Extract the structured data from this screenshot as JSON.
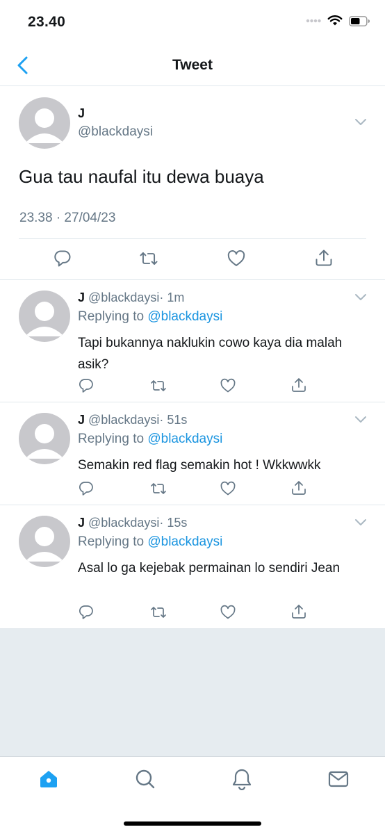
{
  "status_bar": {
    "time": "23.40"
  },
  "nav": {
    "title": "Tweet",
    "back_icon": "chevron-left-icon"
  },
  "main_tweet": {
    "name": "J",
    "handle": "@blackdaysi",
    "text": "Gua tau naufal itu dewa buaya",
    "timestamp": "23.38 · 27/04/23"
  },
  "replies": [
    {
      "name": "J",
      "handle": "@blackdaysi",
      "time": "· 1m",
      "replying_label": "Replying to",
      "replying_to": "@blackdaysi",
      "text": "Tapi bukannya naklukin cowo kaya dia malah asik?"
    },
    {
      "name": "J",
      "handle": "@blackdaysi",
      "time": "· 51s",
      "replying_label": "Replying to",
      "replying_to": "@blackdaysi",
      "text": "Semakin red flag semakin hot !  Wkkwwkk"
    },
    {
      "name": "J",
      "handle": "@blackdaysi",
      "time": "· 15s",
      "replying_label": "Replying to",
      "replying_to": "@blackdaysi",
      "text": "Asal lo ga kejebak permainan lo sendiri Jean"
    }
  ],
  "tab_bar": {
    "items": [
      "home-icon",
      "search-icon",
      "notifications-icon",
      "messages-icon"
    ],
    "active": "home-icon"
  },
  "colors": {
    "accent": "#1da1f2",
    "mention": "#1b95e0",
    "secondary_text": "#657786",
    "background_gray": "#e6ecf0"
  }
}
